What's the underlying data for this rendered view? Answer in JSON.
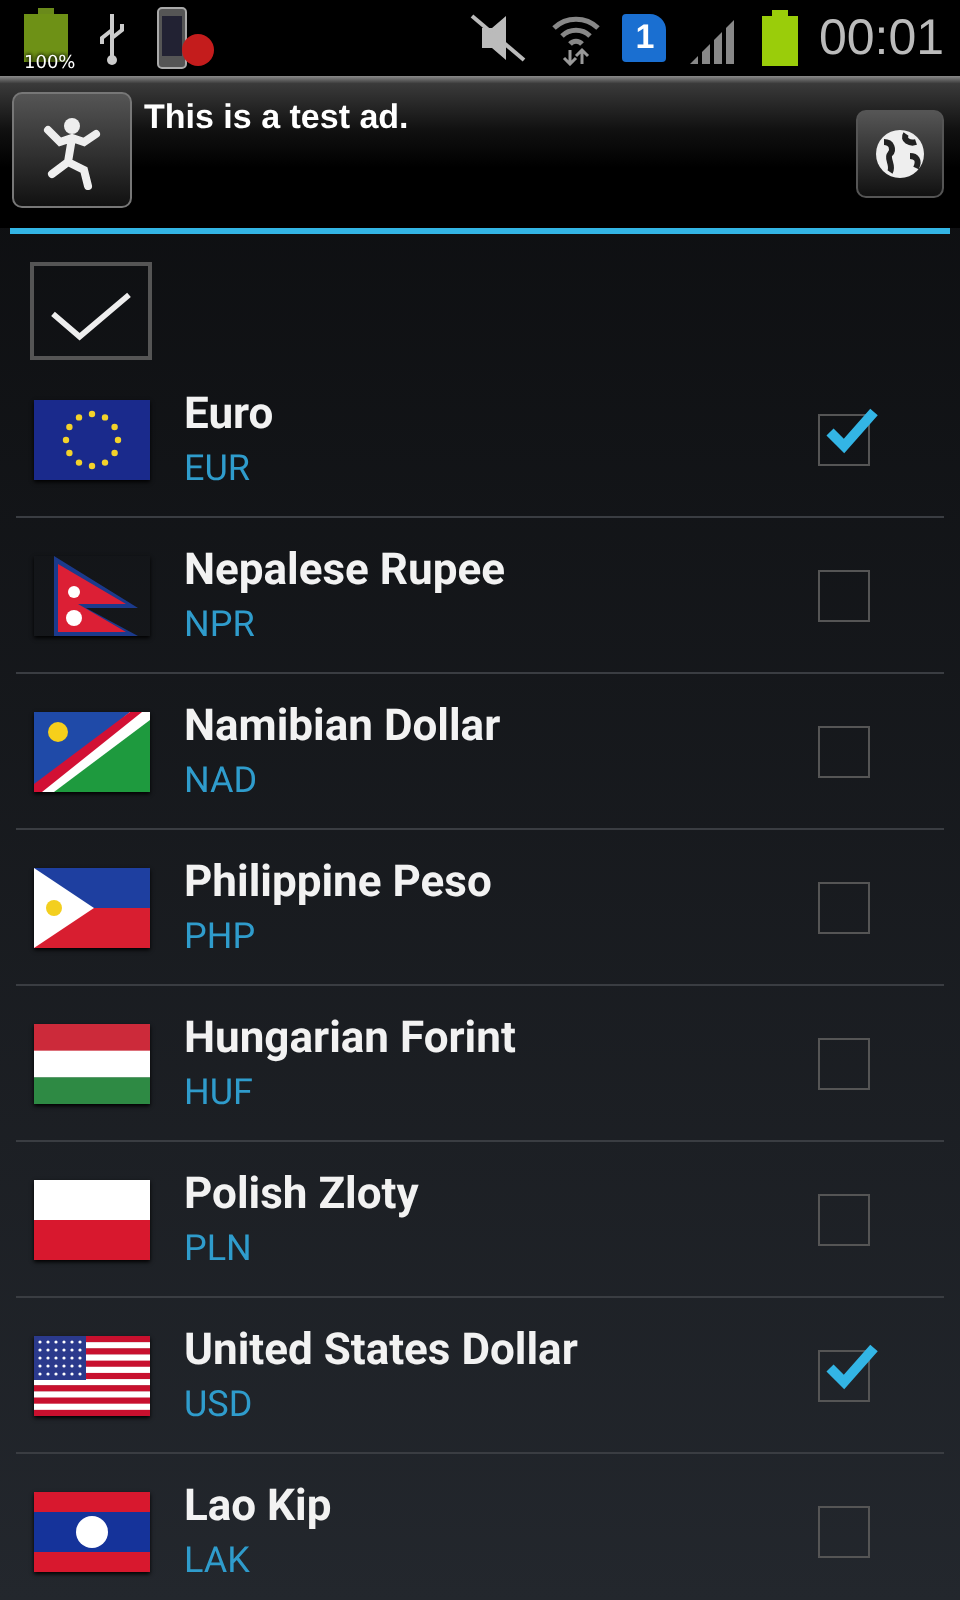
{
  "status_bar": {
    "battery_percent": "100%",
    "sim_slot": "1",
    "time": "00:01"
  },
  "ad": {
    "text": "This is a test ad."
  },
  "select_all": {
    "checked": true
  },
  "currencies": [
    {
      "name": "Euro",
      "code": "EUR",
      "kind": "eu",
      "checked": true
    },
    {
      "name": "Nepalese Rupee",
      "code": "NPR",
      "kind": "np",
      "checked": false
    },
    {
      "name": "Namibian Dollar",
      "code": "NAD",
      "kind": "na",
      "checked": false
    },
    {
      "name": "Philippine Peso",
      "code": "PHP",
      "kind": "ph",
      "checked": false
    },
    {
      "name": "Hungarian Forint",
      "code": "HUF",
      "kind": "hu",
      "checked": false
    },
    {
      "name": "Polish Zloty",
      "code": "PLN",
      "kind": "pl",
      "checked": false
    },
    {
      "name": "United States Dollar",
      "code": "USD",
      "kind": "us",
      "checked": true
    },
    {
      "name": "Lao Kip",
      "code": "LAK",
      "kind": "la",
      "checked": false
    }
  ]
}
